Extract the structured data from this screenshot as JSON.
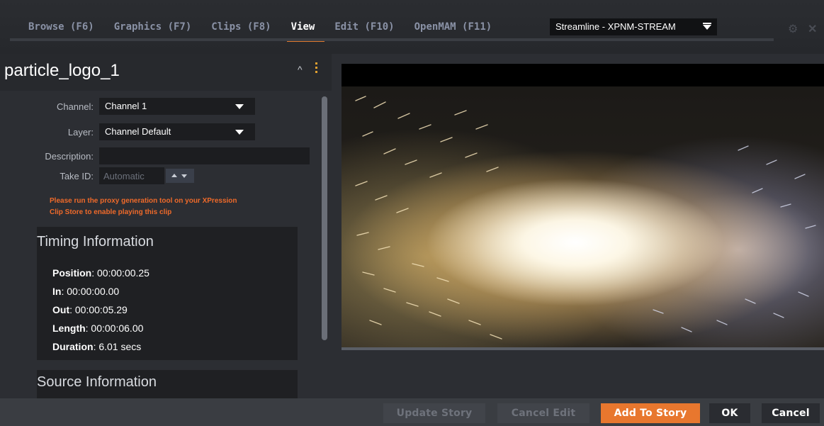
{
  "tabs": [
    {
      "label": "Browse (F6)",
      "active": false
    },
    {
      "label": "Graphics (F7)",
      "active": false
    },
    {
      "label": "Clips (F8)",
      "active": false
    },
    {
      "label": "View",
      "active": true
    },
    {
      "label": "Edit (F10)",
      "active": false
    },
    {
      "label": "OpenMAM (F11)",
      "active": false
    }
  ],
  "server_select": {
    "value": "Streamline - XPNM-STREAM"
  },
  "header_icons": [
    "gear-icon",
    "close-icon"
  ],
  "clip": {
    "title": "particle_logo_1"
  },
  "form": {
    "channel_label": "Channel:",
    "channel_value": "Channel 1",
    "layer_label": "Layer:",
    "layer_value": "Channel Default",
    "description_label": "Description:",
    "description_value": "",
    "take_id_label": "Take ID:",
    "take_id_placeholder": "Automatic"
  },
  "warning": {
    "line1": "Please run the proxy generation tool on your XPression",
    "line2": "Clip Store to enable playing this clip"
  },
  "timing": {
    "title": "Timing Information",
    "position_label": "Position",
    "position_value": ": 00:00:00.25",
    "in_label": "In",
    "in_value": ": 00:00:00.00",
    "out_label": "Out",
    "out_value": ": 00:00:05.29",
    "length_label": "Length",
    "length_value": ": 00:00:06.00",
    "duration_label": "Duration",
    "duration_value": ": 6.01 secs"
  },
  "source": {
    "title": "Source Information"
  },
  "actions": {
    "update_story": "Update Story",
    "cancel_edit": "Cancel Edit",
    "add_to_story": "Add To Story",
    "ok": "OK",
    "cancel": "Cancel"
  },
  "colors": {
    "accent": "#e8772e",
    "warning_text": "#ef6a2a",
    "background": "#2a2c30"
  }
}
